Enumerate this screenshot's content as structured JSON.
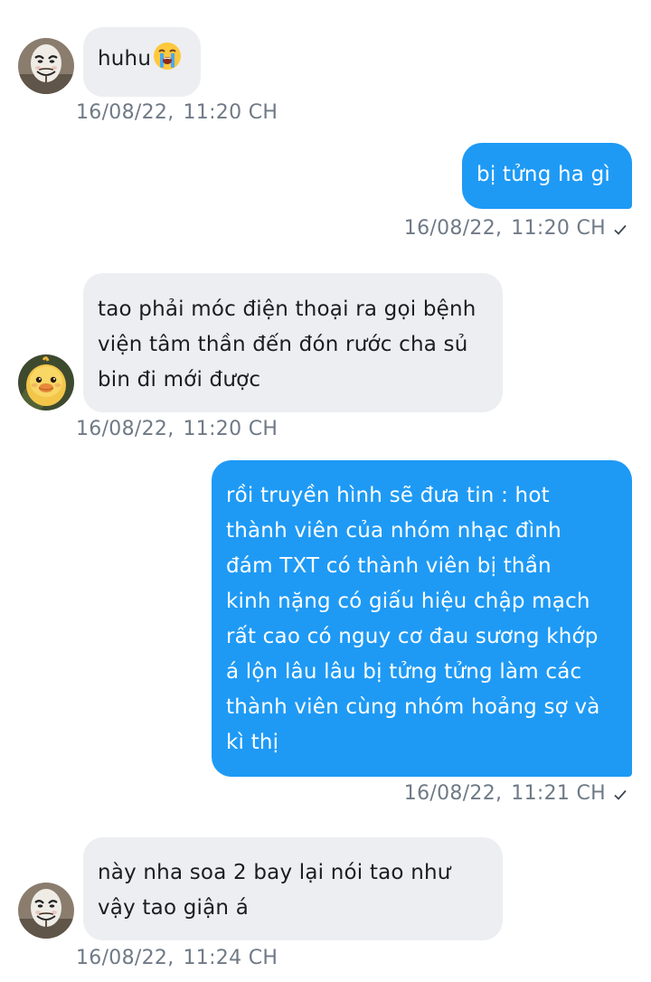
{
  "conversation": {
    "messages": [
      {
        "direction": "incoming",
        "avatar": "guy-fawkes-mask-avatar",
        "lines": [
          "huhu"
        ],
        "emoji": "loudly-crying-face-emoji",
        "date": "16/08/22,",
        "time": "11:20 CH"
      },
      {
        "direction": "outgoing",
        "lines": [
          "bị tửng ha gì"
        ],
        "date": "16/08/22,",
        "time": "11:20 CH",
        "status": "sent-check-icon"
      },
      {
        "direction": "incoming",
        "avatar": "yellow-duckling-avatar",
        "lines": [
          "tao phải móc điện thoại ra gọi bệnh",
          "viện tâm thần đến đón rước cha sủ",
          "bin đi mới được"
        ],
        "date": "16/08/22,",
        "time": "11:20 CH"
      },
      {
        "direction": "outgoing",
        "lines": [
          "rồi truyền hình sẽ đưa tin : hot",
          "thành viên của nhóm nhạc đình",
          "đám TXT có thành viên bị thần",
          "kinh nặng có giấu hiệu chập mạch",
          "rất cao có nguy cơ đau sương khớp",
          "á lộn lâu lâu bị tửng tửng làm các",
          "thành viên cùng nhóm hoảng sợ và",
          "kì thị"
        ],
        "date": "16/08/22,",
        "time": "11:21 CH",
        "status": "sent-check-icon"
      },
      {
        "direction": "incoming",
        "avatar": "guy-fawkes-mask-avatar",
        "lines": [
          "này nha soa 2 bay lại nói tao như",
          "vậy tao giận á"
        ],
        "date": "16/08/22,",
        "time": "11:24 CH"
      }
    ]
  },
  "colors": {
    "incoming_bubble": "#eceef1",
    "outgoing_bubble": "#1e9af5",
    "timestamp": "#6f7a86"
  }
}
